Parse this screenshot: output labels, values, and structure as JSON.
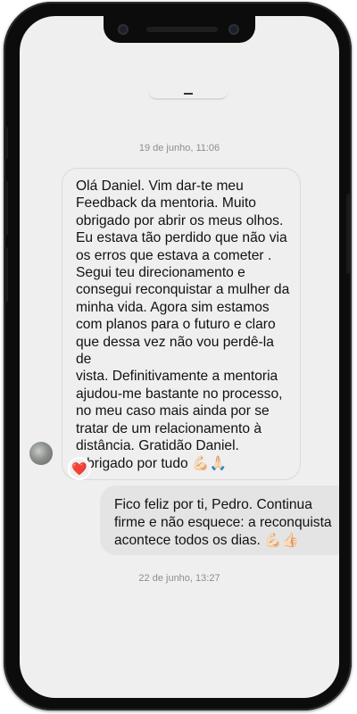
{
  "chat": {
    "timestamp_1": "19 de junho, 11:06",
    "incoming_message": "Olá Daniel. Vim dar-te meu\nFeedback da mentoria. Muito\nobrigado por abrir os meus olhos.\nEu estava tão perdido que não via\nos erros que estava a cometer .\nSegui teu direcionamento e\nconsegui reconquistar a mulher da\nminha vida. Agora sim estamos\ncom planos para o futuro e claro\nque dessa vez não vou perdê-la de\nvista.  Definitivamente a mentoria\najudou-me bastante no processo,\nno meu caso mais ainda por se\ntratar de um relacionamento à\ndistância. Gratidão Daniel.\nObrigado por tudo 💪🏻🙏🏻",
    "reaction": "❤️",
    "outgoing_message": "Fico feliz por ti, Pedro. Continua\nfirme e não esquece: a reconquista\nacontece todos os dias. 💪🏻👍🏻",
    "timestamp_2": "22 de junho, 13:27"
  },
  "icons": {
    "reaction": "heart-icon",
    "avatar": "contact-avatar"
  },
  "colors": {
    "screen_bg": "#efefef",
    "outgoing_bubble": "#e4e4e4",
    "timestamp": "#8e8e8e",
    "heart": "#e0245e"
  }
}
